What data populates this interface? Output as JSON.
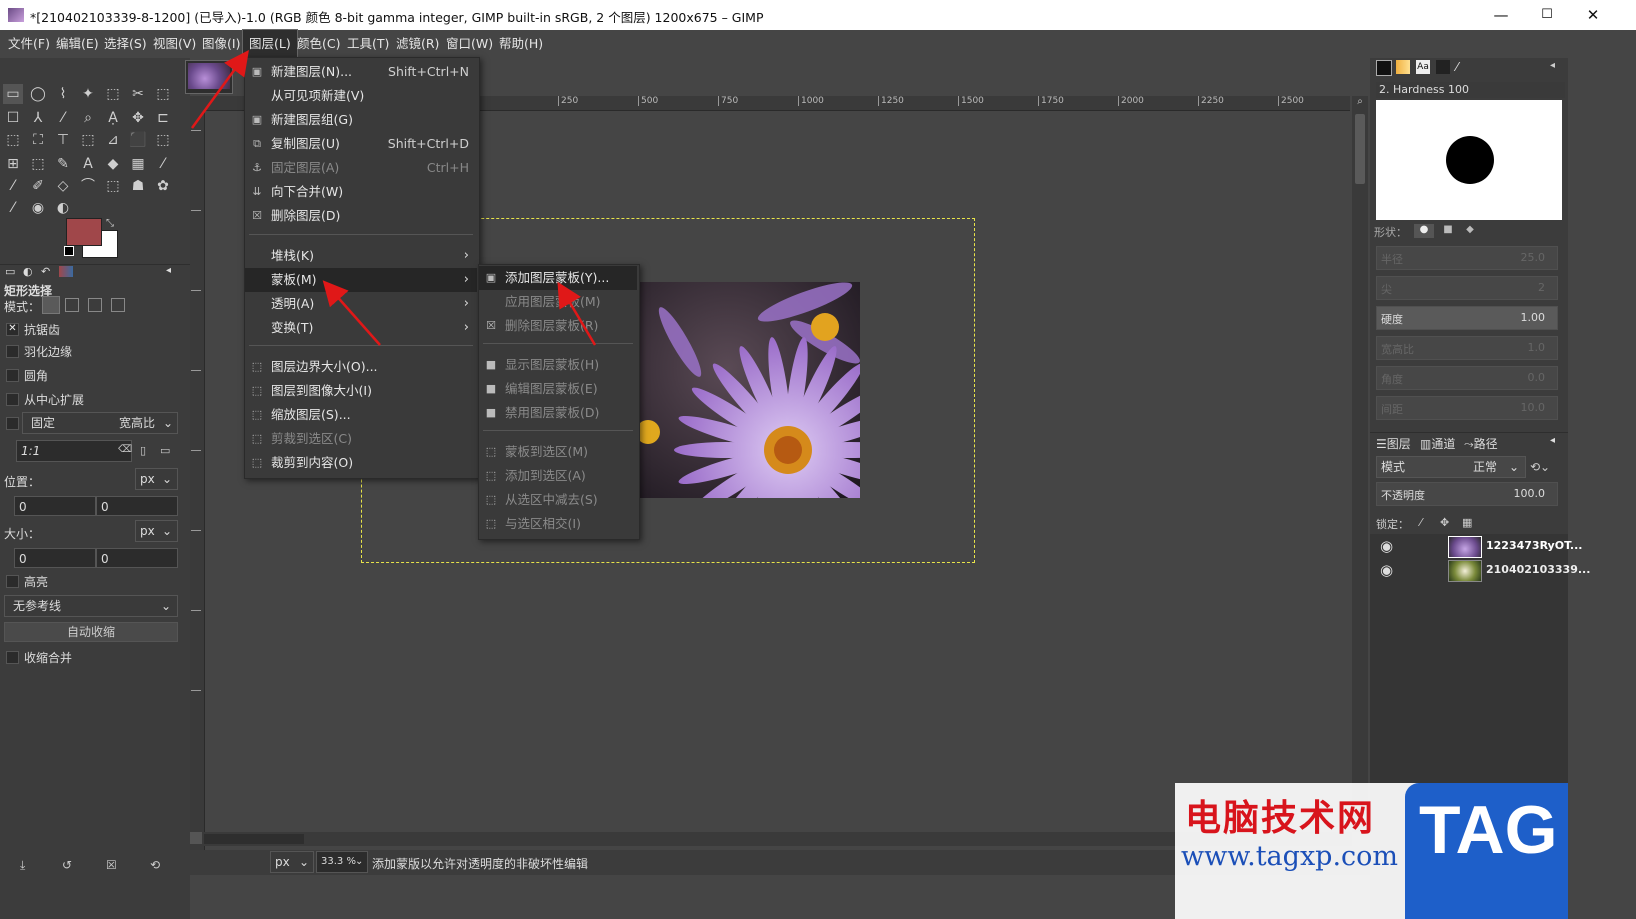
{
  "window": {
    "title": "*[210402103339-8-1200] (已导入)-1.0 (RGB 颜色 8-bit gamma integer, GIMP built-in sRGB, 2 个图层) 1200x675 – GIMP",
    "min": "—",
    "max": "☐",
    "close": "✕"
  },
  "menubar": [
    "文件(F)",
    "编辑(E)",
    "选择(S)",
    "视图(V)",
    "图像(I)",
    "图层(L)",
    "颜色(C)",
    "工具(T)",
    "滤镜(R)",
    "窗口(W)",
    "帮助(H)"
  ],
  "layer_menu": {
    "items": [
      {
        "label": "新建图层(N)...",
        "shortcut": "Shift+Ctrl+N",
        "disabled": false
      },
      {
        "label": "从可见项新建(V)",
        "shortcut": "",
        "disabled": false
      },
      {
        "label": "新建图层组(G)",
        "shortcut": "",
        "disabled": false
      },
      {
        "label": "复制图层(U)",
        "shortcut": "Shift+Ctrl+D",
        "disabled": false
      },
      {
        "label": "固定图层(A)",
        "shortcut": "Ctrl+H",
        "disabled": true
      },
      {
        "label": "向下合并(W)",
        "shortcut": "",
        "disabled": false
      },
      {
        "label": "删除图层(D)",
        "shortcut": "",
        "disabled": false
      },
      {
        "label": "堆栈(K)",
        "shortcut": "",
        "disabled": false
      },
      {
        "label": "蒙板(M)",
        "shortcut": "",
        "disabled": false
      },
      {
        "label": "透明(A)",
        "shortcut": "",
        "disabled": false
      },
      {
        "label": "变换(T)",
        "shortcut": "",
        "disabled": false
      },
      {
        "label": "图层边界大小(O)...",
        "shortcut": "",
        "disabled": false
      },
      {
        "label": "图层到图像大小(I)",
        "shortcut": "",
        "disabled": false
      },
      {
        "label": "缩放图层(S)...",
        "shortcut": "",
        "disabled": false
      },
      {
        "label": "剪裁到选区(C)",
        "shortcut": "",
        "disabled": true
      },
      {
        "label": "裁剪到内容(O)",
        "shortcut": "",
        "disabled": false
      }
    ]
  },
  "mask_menu": {
    "items": [
      {
        "label": "添加图层蒙板(Y)...",
        "disabled": false
      },
      {
        "label": "应用图层蒙板(M)",
        "disabled": true
      },
      {
        "label": "删除图层蒙板(R)",
        "disabled": true
      },
      {
        "label": "显示图层蒙板(H)",
        "disabled": true
      },
      {
        "label": "编辑图层蒙板(E)",
        "disabled": true
      },
      {
        "label": "禁用图层蒙板(D)",
        "disabled": true
      },
      {
        "label": "蒙板到选区(M)",
        "disabled": true
      },
      {
        "label": "添加到选区(A)",
        "disabled": true
      },
      {
        "label": "从选区中减去(S)",
        "disabled": true
      },
      {
        "label": "与选区相交(I)",
        "disabled": true
      }
    ]
  },
  "ruler_ticks": [
    "250",
    "500",
    "750",
    "1000",
    "1250",
    "1500",
    "1750",
    "2000",
    "2250",
    "2500"
  ],
  "tool_options": {
    "title": "矩形选择",
    "mode_label": "模式：",
    "antialias": "抗锯齿",
    "feather": "羽化边缘",
    "rounded": "圆角",
    "expand_center": "从中心扩展",
    "fixed": "固定",
    "aspect": "宽高比",
    "ratio": "1:1",
    "position_label": "位置：",
    "size_label": "大小：",
    "unit": "px",
    "pos_x": "0",
    "pos_y": "0",
    "size_w": "0",
    "size_h": "0",
    "highlight": "高亮",
    "guides": "无参考线",
    "auto_shrink": "自动收缩",
    "shrink_merged": "收缩合并"
  },
  "colors": {
    "foreground": "#a0474a",
    "background": "#ffffff",
    "selection_dash": "#e8e34a"
  },
  "brushes": {
    "name": "2. Hardness 100",
    "shape_label": "形状：",
    "hardness_label": "硬度",
    "hardness_value": "1.00",
    "dim_sliders": [
      {
        "label": "半径",
        "value": "25.0"
      },
      {
        "label": "尖",
        "value": "2"
      },
      {
        "label": "宽高比",
        "value": "1.0"
      },
      {
        "label": "角度",
        "value": "0.0"
      },
      {
        "label": "间距",
        "value": "10.0"
      }
    ]
  },
  "layers_panel": {
    "tabs": [
      "图层",
      "通道",
      "路径"
    ],
    "mode_label": "模式",
    "mode_value": "正常",
    "opacity_label": "不透明度",
    "opacity_value": "100.0",
    "lock_label": "锁定：",
    "layers": [
      {
        "name": "1223473RyOT..."
      },
      {
        "name": "210402103339..."
      }
    ]
  },
  "statusbar": {
    "unit": "px",
    "zoom": "33.3 %",
    "message": "添加蒙版以允许对透明度的非破坏性编辑"
  },
  "watermark": {
    "title": "电脑技术网",
    "url": "www.tagxp.com",
    "tag": "TAG"
  }
}
